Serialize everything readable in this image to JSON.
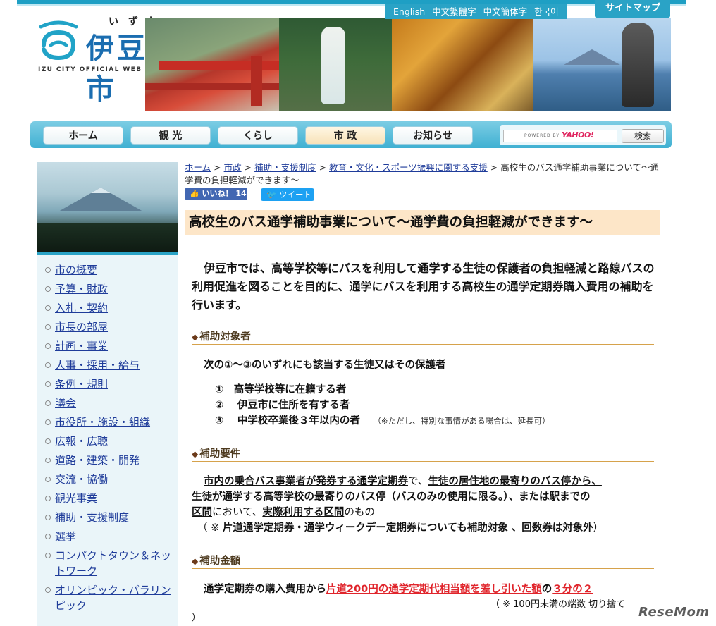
{
  "header": {
    "logo_ruby": "いずし",
    "logo_title": "伊豆市",
    "logo_sub": "IZU CITY OFFICIAL WEB SITE",
    "lang_links": [
      "English",
      "中文繁體字",
      "中文簡体字",
      "한국어"
    ],
    "sitemap_label": "サイトマップ"
  },
  "nav": {
    "tabs": [
      "ホーム",
      "観 光",
      "くらし",
      "市 政",
      "お知らせ"
    ],
    "active_tab": "市 政",
    "search_powered": "POWERED BY",
    "search_brand": "YAHOO!",
    "search_button": "検索"
  },
  "sidebar": {
    "items": [
      "市の概要",
      "予算・財政",
      "入札・契約",
      "市長の部屋",
      "計画・事業",
      "人事・採用・給与",
      "条例・規則",
      "議会",
      "市役所・施設・組織",
      "広報・広聴",
      "道路・建築・開発",
      "交流・協働",
      "観光事業",
      "補助・支援制度",
      "選挙",
      "コンパクトタウン＆ネットワーク",
      "オリンピック・パラリンピック"
    ]
  },
  "breadcrumb": {
    "links": [
      "ホーム",
      "市政",
      "補助・支援制度",
      "教育・文化・スポーツ振興に関する支援"
    ],
    "separator": ">",
    "current": "高校生のバス通学補助事業について～通学費の負担軽減ができます～"
  },
  "social": {
    "like_label": "いいね！ 14",
    "tweet_label": "ツイート"
  },
  "content": {
    "title": "高校生のバス通学補助事業について～通学費の負担軽減ができます～",
    "intro": "伊豆市では、高等学校等にバスを利用して通学する生徒の保護者の負担軽減と路線バスの利用促進を図ることを目的に、通学にバスを利用する高校生の通学定期券購入費用の補助を行います。",
    "section1": {
      "heading": "補助対象者",
      "lead": "次の①～③のいずれにも該当する生徒又はその保護者",
      "items": [
        "①　高等学校等に在籍する者",
        "②　 伊豆市に住所を有する者",
        "③　 中学校卒業後３年以内の者"
      ],
      "note": "（※ただし、特別な事情がある場合は、延長可）"
    },
    "section2": {
      "heading": "補助要件",
      "p1a": "市内の乗合バス事業者が発券する通学定期券",
      "p1b": "で、",
      "p1c": "生徒の居住地の最寄りのバス停から、",
      "p2a": "生徒が通学する高等学校の最寄りのバス停（バスのみの使用に限る。）、または駅までの",
      "p3a": "区間",
      "p3b": "において、",
      "p3c": "実際利用する区間",
      "p3d": "のもの",
      "p4a": "（ ※ ",
      "p4b": "片道通学定期券・通学ウィークデー定期券についても補助対象 、回数券は対象外",
      "p4c": "）"
    },
    "section3": {
      "heading": "補助金額",
      "p1a": "通学定期券の購入費用から",
      "p1b": "片道200円の通学定期代相当額を差し引いた額",
      "p1c": "の",
      "p1d": "３分の２",
      "note": "（ ※ 100円未満の端数 切り捨て",
      "close": "）"
    }
  },
  "watermark": "ReseMom",
  "colors": {
    "brand": "#2aa3c6",
    "title_bg": "#fde6c8",
    "section_rule": "#d6a24b",
    "link": "#1f3c9a",
    "highlight": "#e0242b"
  }
}
